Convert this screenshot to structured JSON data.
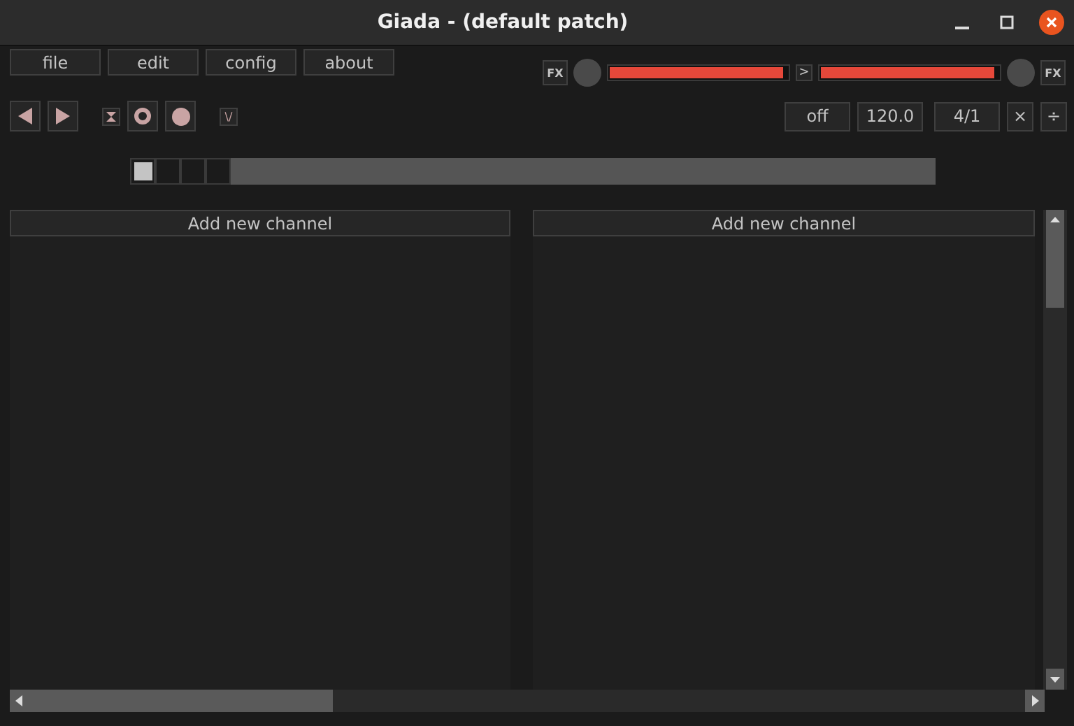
{
  "window": {
    "title": "Giada - (default patch)"
  },
  "menu": [
    "file",
    "edit",
    "config",
    "about"
  ],
  "master": {
    "input_fx": "FX",
    "input_meter": {
      "level": 0.98
    },
    "monitor": ">",
    "output_meter": {
      "level": 0.98
    },
    "output_fx": "FX"
  },
  "transport": {
    "input_rec": "\\/"
  },
  "timing": {
    "quantize": "off",
    "bpm": "120.0",
    "meter": "4/1",
    "multiply": "×",
    "divide": "÷"
  },
  "beats": [
    {
      "selected": true
    },
    {
      "selected": false
    },
    {
      "selected": false
    },
    {
      "selected": false
    }
  ],
  "columns": [
    {
      "add_button": "Add new channel"
    },
    {
      "add_button": "Add new channel"
    }
  ]
}
